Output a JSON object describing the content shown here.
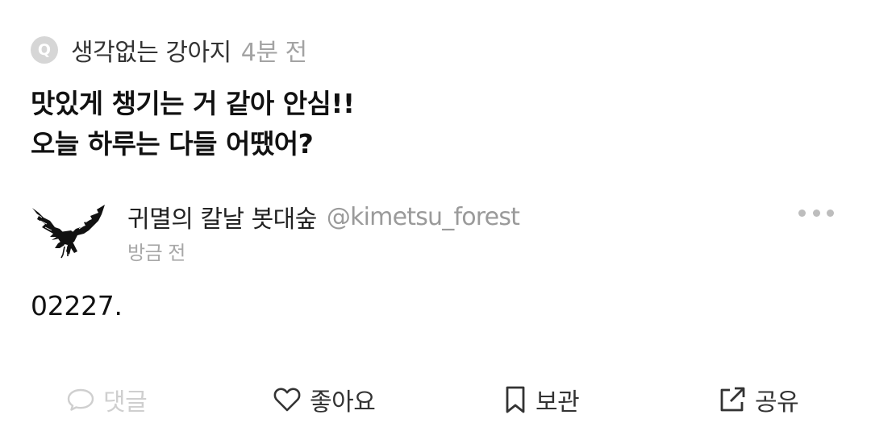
{
  "question": {
    "badge": "Q",
    "asker": "생각없는 강아지",
    "time": "4분 전",
    "lines": [
      "맛있게 챙기는 거 같아 안심!!",
      "오늘 하루는 다들 어땠어?"
    ]
  },
  "answer": {
    "name": "귀멸의 칼날 봇대숲",
    "handle": "@kimetsu_forest",
    "time": "방금 전",
    "text": "02227.",
    "avatar_icon": "crow-icon",
    "more_icon": "more-dots-icon"
  },
  "actions": {
    "comment": {
      "label": "댓글",
      "icon": "comment-bubble-icon",
      "color": "#cfcfcf"
    },
    "like": {
      "label": "좋아요",
      "icon": "heart-outline-icon",
      "color": "#333333"
    },
    "save": {
      "label": "보관",
      "icon": "bookmark-icon",
      "color": "#333333"
    },
    "share": {
      "label": "공유",
      "icon": "share-external-icon",
      "color": "#333333"
    }
  }
}
